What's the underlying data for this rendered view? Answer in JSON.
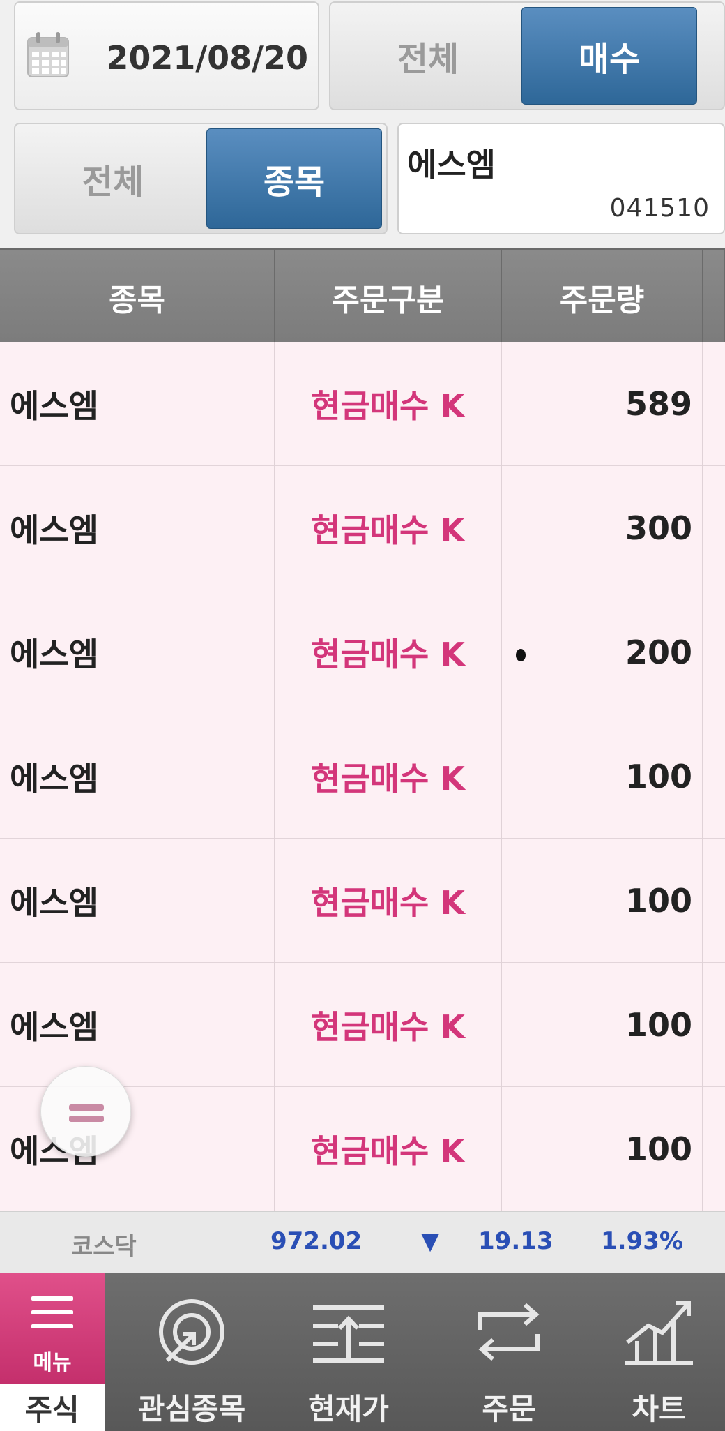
{
  "filters": {
    "date": "2021/08/20",
    "type_all_label": "전체",
    "type_buy_label": "매수",
    "stock_all_label": "전체",
    "stock_item_label": "종목",
    "stock_name": "에스엠",
    "stock_code": "041510"
  },
  "table": {
    "headers": [
      "종목",
      "주문구분",
      "주문량"
    ],
    "rows": [
      {
        "name": "에스엠",
        "kind": "현금매수 K",
        "qty": "589"
      },
      {
        "name": "에스엠",
        "kind": "현금매수 K",
        "qty": "300"
      },
      {
        "name": "에스엠",
        "kind": "현금매수 K",
        "qty": "200"
      },
      {
        "name": "에스엠",
        "kind": "현금매수 K",
        "qty": "100"
      },
      {
        "name": "에스엠",
        "kind": "현금매수 K",
        "qty": "100"
      },
      {
        "name": "에스엠",
        "kind": "현금매수 K",
        "qty": "100"
      },
      {
        "name": "에스엠",
        "kind": "현금매수 K",
        "qty": "100"
      }
    ]
  },
  "index": {
    "name": "코스닥",
    "value": "972.02",
    "arrow": "▼",
    "change": "19.13",
    "rate": "1.93%"
  },
  "nav": {
    "menu_label": "메뉴",
    "home_tab": "주식",
    "items": [
      "관심종목",
      "현재가",
      "주문",
      "차트"
    ]
  },
  "colors": {
    "accent_blue": "#2e6798",
    "order_pink": "#d3367a",
    "index_blue": "#2a4fb5",
    "menu_pink": "#c42f6c"
  }
}
